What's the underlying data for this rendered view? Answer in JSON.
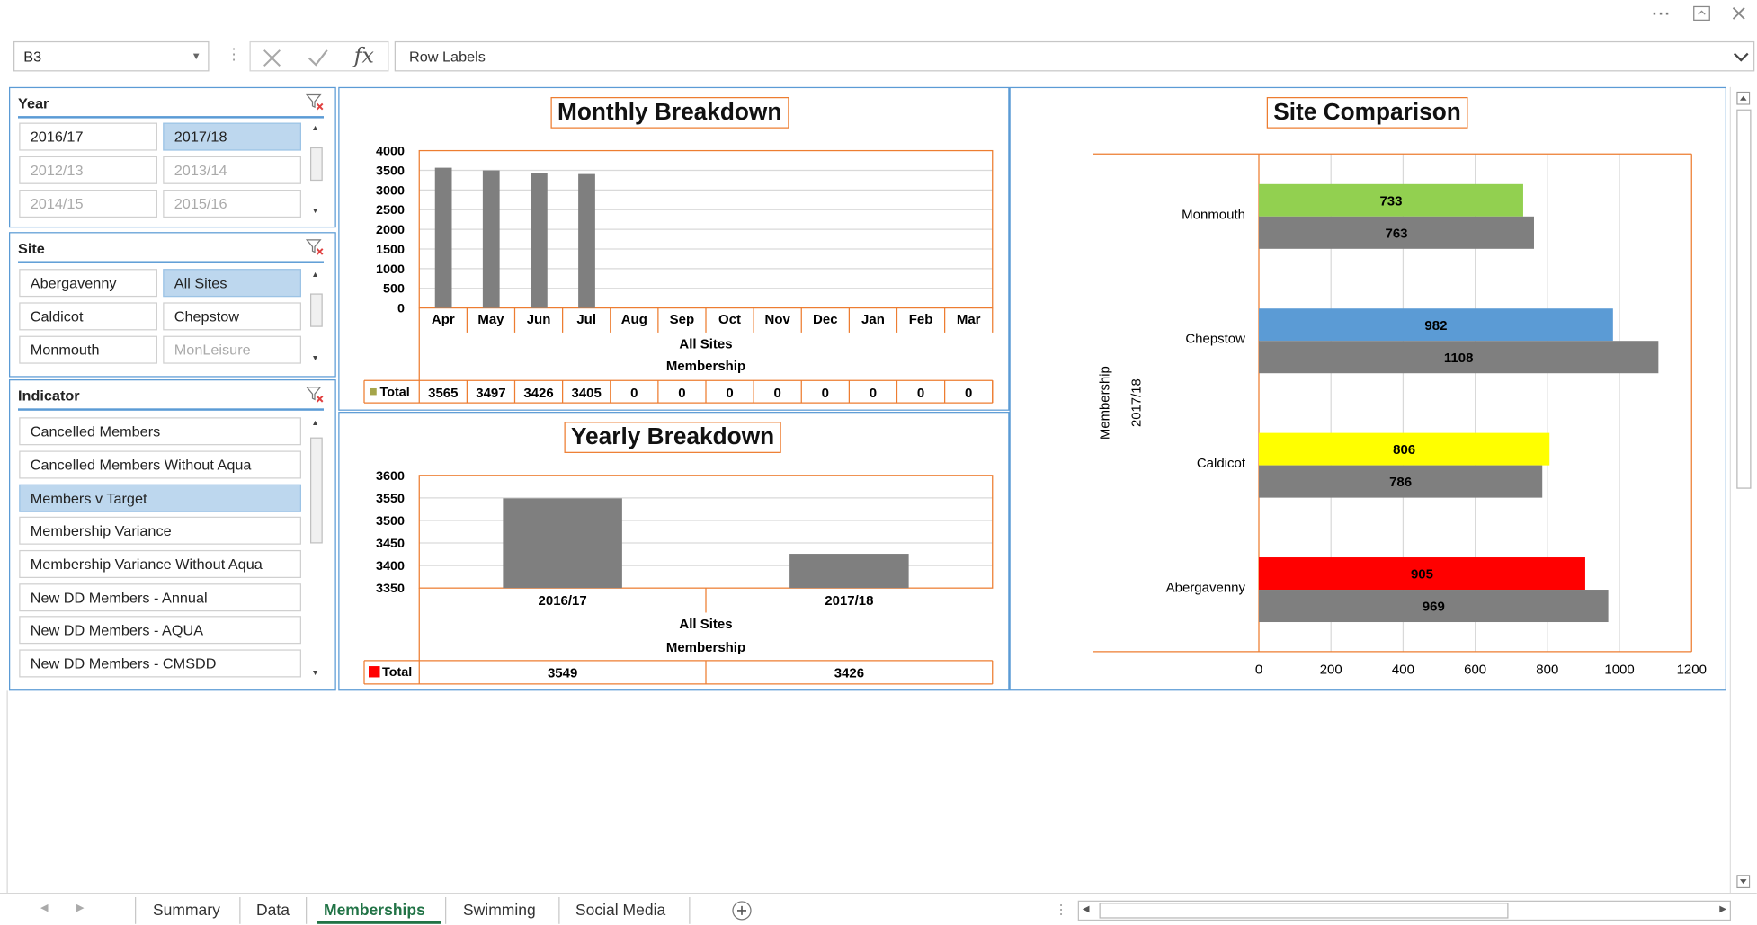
{
  "toolbar": {
    "name_box": "B3",
    "formula_value": "Row Labels",
    "more_label": "···"
  },
  "slicers": {
    "year": {
      "title": "Year",
      "items": [
        {
          "label": "2016/17",
          "state": "normal"
        },
        {
          "label": "2017/18",
          "state": "selected"
        },
        {
          "label": "2012/13",
          "state": "dimmed"
        },
        {
          "label": "2013/14",
          "state": "dimmed"
        },
        {
          "label": "2014/15",
          "state": "dimmed"
        },
        {
          "label": "2015/16",
          "state": "dimmed"
        }
      ]
    },
    "site": {
      "title": "Site",
      "items": [
        {
          "label": "Abergavenny",
          "state": "normal"
        },
        {
          "label": "All Sites",
          "state": "selected"
        },
        {
          "label": "Caldicot",
          "state": "normal"
        },
        {
          "label": "Chepstow",
          "state": "normal"
        },
        {
          "label": "Monmouth",
          "state": "normal"
        },
        {
          "label": "MonLeisure",
          "state": "dimmed"
        }
      ]
    },
    "indicator": {
      "title": "Indicator",
      "items": [
        {
          "label": "Cancelled Members",
          "state": "normal"
        },
        {
          "label": "Cancelled Members Without Aqua",
          "state": "normal"
        },
        {
          "label": "Members v Target",
          "state": "selected"
        },
        {
          "label": "Membership Variance",
          "state": "normal"
        },
        {
          "label": "Membership Variance Without Aqua",
          "state": "normal"
        },
        {
          "label": "New DD Members - Annual",
          "state": "normal"
        },
        {
          "label": "New DD Members - AQUA",
          "state": "normal"
        },
        {
          "label": "New DD Members - CMSDD",
          "state": "normal"
        }
      ]
    }
  },
  "chart_data": [
    {
      "type": "bar",
      "title": "Monthly Breakdown",
      "categories": [
        "Apr",
        "May",
        "Jun",
        "Jul",
        "Aug",
        "Sep",
        "Oct",
        "Nov",
        "Dec",
        "Jan",
        "Feb",
        "Mar"
      ],
      "series": [
        {
          "name": "Total",
          "values": [
            3565,
            3497,
            3426,
            3405,
            0,
            0,
            0,
            0,
            0,
            0,
            0,
            0
          ],
          "color": "#7f7f7f"
        }
      ],
      "table_values": [
        "3565",
        "3497",
        "3426",
        "3405",
        "0",
        "0",
        "0",
        "0",
        "0",
        "0",
        "0",
        "0"
      ],
      "legend_color": "#a5a54a",
      "y_ticks": [
        "4000",
        "3500",
        "3000",
        "2500",
        "2000",
        "1500",
        "1000",
        "500",
        "0"
      ],
      "ylim": [
        0,
        4000
      ],
      "axis_labels": [
        "All Sites",
        "Membership"
      ],
      "grid": true
    },
    {
      "type": "bar",
      "title": "Yearly Breakdown",
      "categories": [
        "2016/17",
        "2017/18"
      ],
      "series": [
        {
          "name": "Total",
          "values": [
            3549,
            3426
          ],
          "color": "#7f7f7f"
        }
      ],
      "table_values": [
        "3549",
        "3426"
      ],
      "legend_color": "#ff0000",
      "y_ticks": [
        "3600",
        "3550",
        "3500",
        "3450",
        "3400",
        "3350"
      ],
      "ylim": [
        3350,
        3600
      ],
      "axis_labels": [
        "All Sites",
        "Membership"
      ],
      "grid": true
    },
    {
      "type": "bar",
      "orientation": "horizontal",
      "title": "Site Comparison",
      "categories": [
        "Monmouth",
        "Chepstow",
        "Caldicot",
        "Abergavenny"
      ],
      "series": [
        {
          "values": [
            733,
            982,
            806,
            905
          ],
          "colors": [
            "#92d050",
            "#5b9bd5",
            "#ffff00",
            "#ff0000"
          ]
        },
        {
          "values": [
            763,
            1108,
            786,
            969
          ],
          "color": "#7f7f7f"
        }
      ],
      "x_ticks": [
        "0",
        "200",
        "400",
        "600",
        "800",
        "1000",
        "1200"
      ],
      "xlim": [
        0,
        1200
      ],
      "axis_labels": [
        "Membership",
        "2017/18"
      ],
      "grid": true
    }
  ],
  "sheet_tabs": [
    "Summary",
    "Data",
    "Memberships",
    "Swimming",
    "Social Media"
  ],
  "active_tab": "Memberships"
}
